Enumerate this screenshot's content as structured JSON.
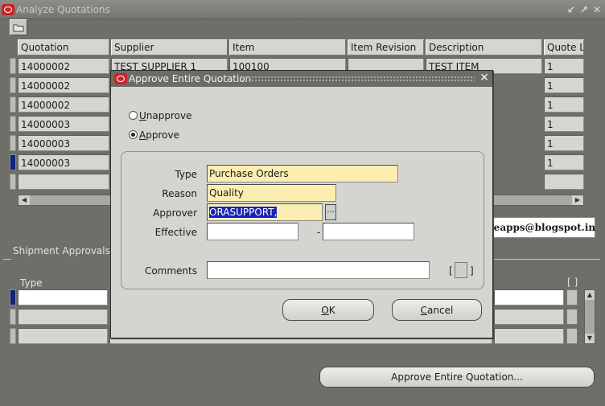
{
  "window": {
    "title": "Analyze Quotations",
    "controls": [
      "↙",
      "↗",
      "✕"
    ]
  },
  "quotations_table": {
    "columns": [
      "Quotation",
      "Supplier",
      "Item",
      "Item Revision",
      "Description",
      "Quote L"
    ],
    "rows": [
      {
        "quotation": "14000002",
        "supplier": "TEST SUPPLIER 1",
        "item": "100100",
        "revision": "",
        "description": "TEST ITEM",
        "quote_line": "1"
      },
      {
        "quotation": "14000002",
        "supplier": "",
        "item": "",
        "revision": "",
        "description": "",
        "quote_line": "1"
      },
      {
        "quotation": "14000002",
        "supplier": "",
        "item": "",
        "revision": "",
        "description": "",
        "quote_line": "1"
      },
      {
        "quotation": "14000003",
        "supplier": "",
        "item": "",
        "revision": "",
        "description": "",
        "quote_line": "1"
      },
      {
        "quotation": "14000003",
        "supplier": "",
        "item": "",
        "revision": "",
        "description": "",
        "quote_line": "1"
      },
      {
        "quotation": "14000003",
        "supplier": "",
        "item": "",
        "revision": "",
        "description": "",
        "quote_line": "1"
      },
      {
        "quotation": "",
        "supplier": "",
        "item": "",
        "revision": "",
        "description": "",
        "quote_line": ""
      }
    ],
    "current_row": 5
  },
  "shipment_approvals": {
    "title": "Shipment Approvals",
    "type_header": "Type",
    "bracket": "[ ]"
  },
  "approve_button": {
    "label": "Approve Entire Quotation..."
  },
  "dialog": {
    "title": "Approve Entire Quotation",
    "radio_unapprove": {
      "mnemonic": "U",
      "rest": "napprove",
      "selected": false
    },
    "radio_approve": {
      "mnemonic": "A",
      "rest": "pprove",
      "selected": true
    },
    "fields": {
      "type_label": "Type",
      "type_value": "Purchase Orders",
      "reason_label": "Reason",
      "reason_value": "Quality",
      "approver_label": "Approver",
      "approver_value": "ORASUPPORT,",
      "lov_button": "...",
      "effective_label": "Effective",
      "effective_from": "",
      "effective_separator": "-",
      "effective_to": "",
      "comments_label": "Comments",
      "comments_value": "",
      "bracket_left": "[",
      "bracket_right": "]"
    },
    "ok_button": {
      "mnemonic": "O",
      "rest": "K"
    },
    "cancel_button": {
      "mnemonic": "C",
      "rest": "ancel"
    }
  },
  "watermark": "dj-oracleapps@blogspot.in"
}
